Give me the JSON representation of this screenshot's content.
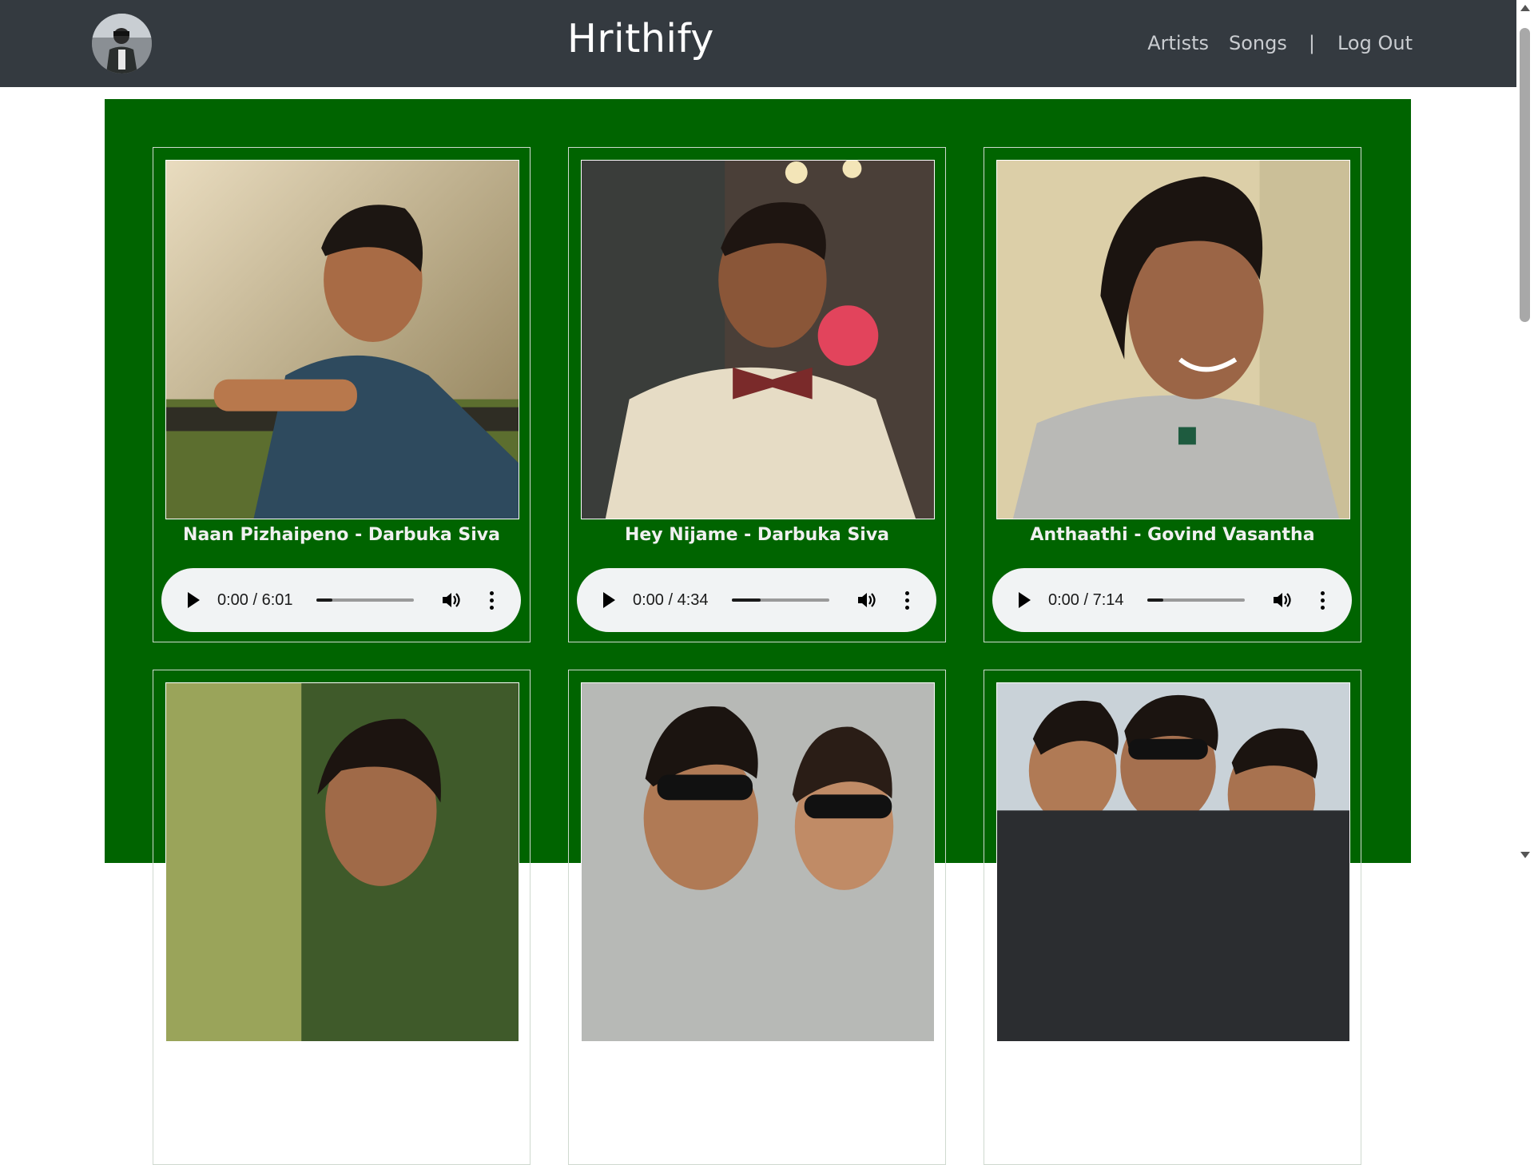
{
  "navbar": {
    "brand": "Hrithify",
    "links": {
      "artists": "Artists",
      "songs": "Songs",
      "separator": "|",
      "logout": "Log Out"
    }
  },
  "colors": {
    "navbar_bg": "#343a40",
    "main_bg": "#006400",
    "player_bg": "#f1f3f4"
  },
  "songs": [
    {
      "title": "Naan Pizhaipeno - Darbuka Siva",
      "time": "0:00 / 6:01",
      "image_icon": "artist-photo-icon"
    },
    {
      "title": "Hey Nijame - Darbuka Siva",
      "time": "0:00 / 4:34",
      "image_icon": "artist-photo-icon"
    },
    {
      "title": "Anthaathi - Govind Vasantha",
      "time": "0:00 / 7:14",
      "image_icon": "artist-photo-icon"
    },
    {
      "title": "",
      "time": "",
      "image_icon": "artist-photo-icon"
    },
    {
      "title": "",
      "time": "",
      "image_icon": "artist-photo-icon"
    },
    {
      "title": "",
      "time": "",
      "image_icon": "artist-photo-icon"
    }
  ]
}
